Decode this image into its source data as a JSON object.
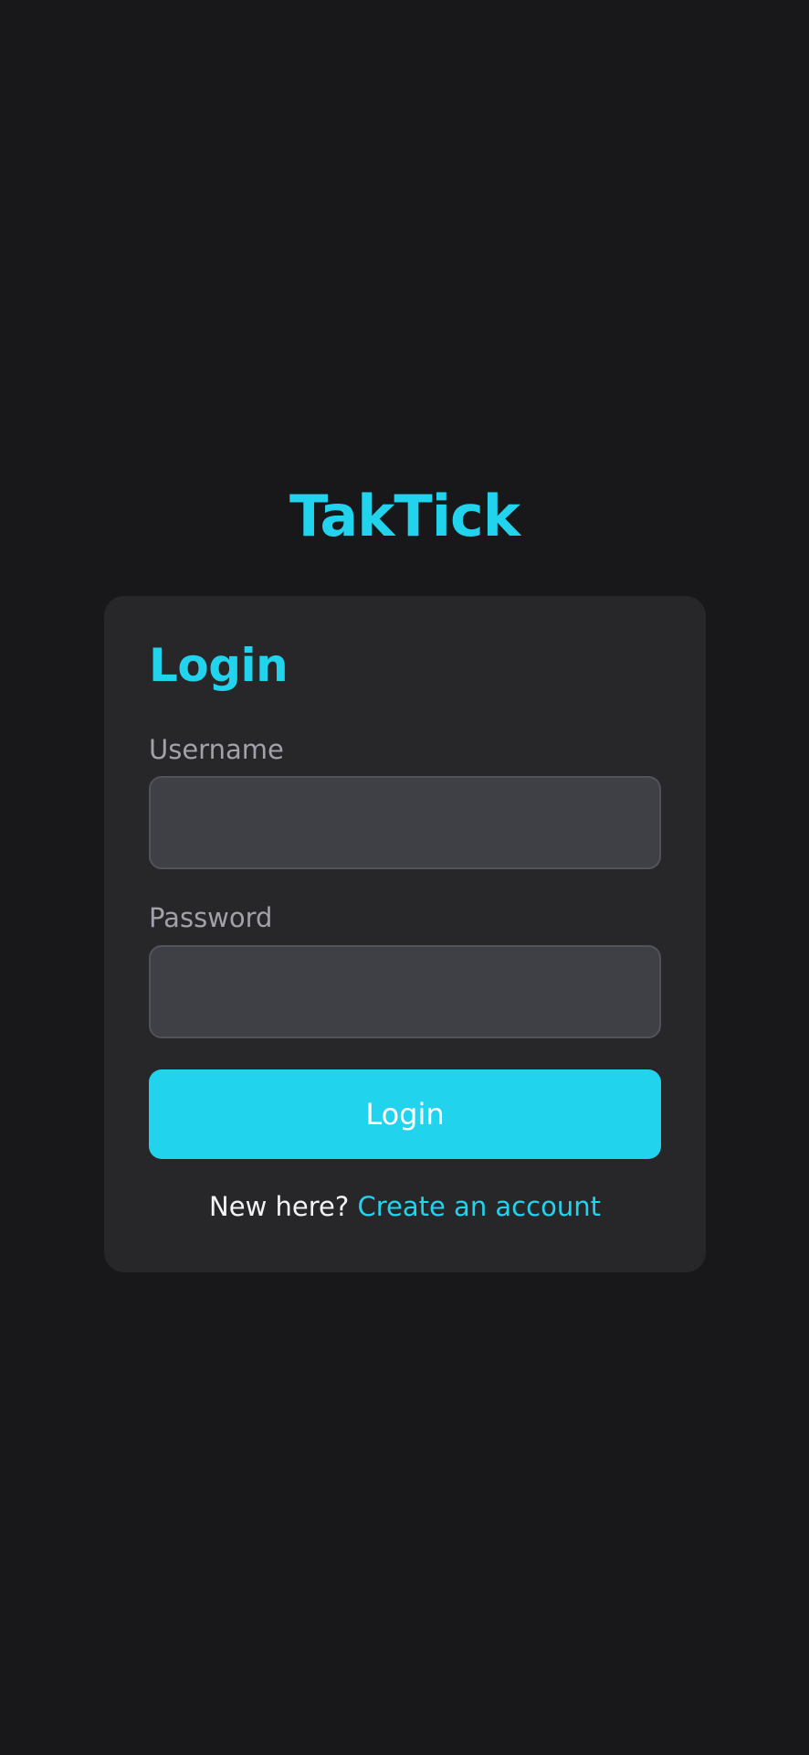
{
  "app": {
    "title": "TakTick"
  },
  "login_card": {
    "title": "Login",
    "username_label": "Username",
    "username_value": "",
    "password_label": "Password",
    "password_value": "",
    "submit_label": "Login",
    "signup_prompt": "New here?",
    "signup_link": "Create an account"
  },
  "colors": {
    "background": "#18181b",
    "card": "#27272a",
    "input": "#3f3f46",
    "accent": "#22d3ee",
    "muted_text": "#a1a1aa",
    "text": "#f4f4f5"
  }
}
